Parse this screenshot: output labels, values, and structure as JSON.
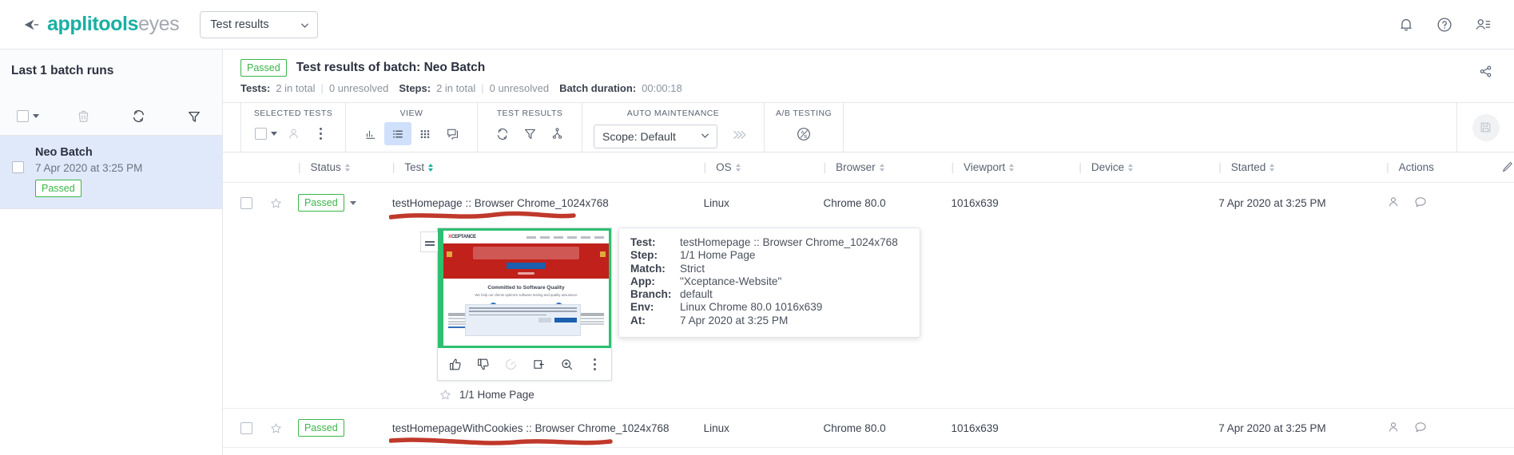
{
  "topbar": {
    "brand_primary": "applitools",
    "brand_secondary": "eyes",
    "selector_value": "Test results",
    "icons": [
      "bell-icon",
      "help-icon",
      "account-icon"
    ]
  },
  "sidebar": {
    "title": "Last 1 batch runs",
    "toolbar_icons": [
      "select-all-checkbox",
      "delete-icon",
      "refresh-icon",
      "filter-icon"
    ],
    "batches": [
      {
        "name": "Neo Batch",
        "date": "7 Apr 2020 at 3:25 PM",
        "status": "Passed"
      }
    ]
  },
  "batch_header": {
    "status": "Passed",
    "title": "Test results of batch: Neo Batch",
    "tests_label": "Tests:",
    "tests_value": "2 in total",
    "tests_unresolved": "0 unresolved",
    "steps_label": "Steps:",
    "steps_value": "2 in total",
    "steps_unresolved": "0 unresolved",
    "duration_label": "Batch duration:",
    "duration_value": "00:00:18",
    "share_icon": "share-icon"
  },
  "toolbar": {
    "groups": [
      {
        "label": "SELECTED TESTS",
        "icons": [
          "checkbox-dropdown",
          "assign-user-icon",
          "more-options-icon"
        ]
      },
      {
        "label": "VIEW",
        "icons": [
          "chart-view-icon",
          "list-view-icon",
          "grid-view-icon",
          "detail-view-icon"
        ]
      },
      {
        "label": "TEST RESULTS",
        "icons": [
          "refresh-icon",
          "filter-icon",
          "branch-icon"
        ]
      },
      {
        "label": "AUTO MAINTENANCE",
        "scope_value": "Scope: Default",
        "icons": [
          "apply-changes-icon"
        ]
      },
      {
        "label": "A/B TESTING",
        "icons": [
          "ab-testing-icon"
        ]
      }
    ],
    "save_icon": "save-icon"
  },
  "table": {
    "columns": [
      {
        "key": "status",
        "label": "Status",
        "sorted": false
      },
      {
        "key": "test",
        "label": "Test",
        "sorted": true
      },
      {
        "key": "os",
        "label": "OS",
        "sorted": false
      },
      {
        "key": "browser",
        "label": "Browser",
        "sorted": false
      },
      {
        "key": "viewport",
        "label": "Viewport",
        "sorted": false
      },
      {
        "key": "device",
        "label": "Device",
        "sorted": false
      },
      {
        "key": "started",
        "label": "Started",
        "sorted": false
      },
      {
        "key": "actions",
        "label": "Actions",
        "sorted": null
      }
    ],
    "edit_icon": "edit-columns-icon",
    "rows": [
      {
        "status": "Passed",
        "test": "testHomepage :: Browser Chrome_1024x768",
        "os": "Linux",
        "browser": "Chrome 80.0",
        "viewport": "1016x639",
        "device": "",
        "started": "7 Apr 2020 at 3:25 PM",
        "expanded": true,
        "has_status_caret": true,
        "annotated": true
      },
      {
        "status": "Passed",
        "test": "testHomepageWithCookies :: Browser Chrome_1024x768",
        "os": "Linux",
        "browser": "Chrome 80.0",
        "viewport": "1016x639",
        "device": "",
        "started": "7 Apr 2020 at 3:25 PM",
        "expanded": false,
        "has_status_caret": false,
        "annotated": true
      }
    ]
  },
  "step_card": {
    "thumbnail_alt": "Xceptance homepage screenshot",
    "thumb_logo_x": "X",
    "thumb_logo_text": "CEPTANCE",
    "thumb_logo_sub": "Software Technologies",
    "thumb_heading": "Committed to Software Quality",
    "thumb_sub": "We help our clients optimize software testing and quality assurance",
    "thumb_cta": "LEARN MORE",
    "tools": [
      "thumbs-up-icon",
      "thumbs-down-icon",
      "annotate-icon",
      "open-in-icon",
      "zoom-in-icon",
      "more-options-icon"
    ],
    "step_star": "star-icon",
    "step_name": "1/1 Home Page"
  },
  "info_popup": {
    "rows": [
      {
        "key": "Test:",
        "value": "testHomepage :: Browser Chrome_1024x768"
      },
      {
        "key": "Step:",
        "value": "1/1 Home Page"
      },
      {
        "key": "Match:",
        "value": "Strict"
      },
      {
        "key": "App:",
        "value": "\"Xceptance-Website\""
      },
      {
        "key": "Branch:",
        "value": "default"
      },
      {
        "key": "Env:",
        "value": "Linux Chrome 80.0 1016x639"
      },
      {
        "key": "At:",
        "value": "7 Apr 2020 at 3:25 PM"
      }
    ]
  },
  "colors": {
    "brand_teal": "#19b0a3",
    "pass_green": "#3bb54a",
    "selection_blue": "#dfe9fa",
    "annotation_red": "#c0392b",
    "border": "#e3e6ea"
  }
}
